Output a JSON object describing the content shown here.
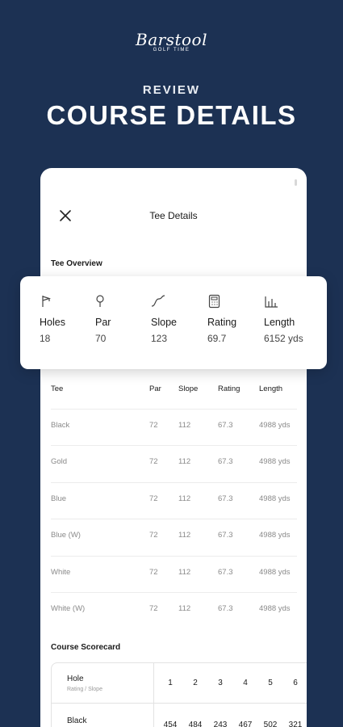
{
  "brand": {
    "name": "Barstool",
    "tagline": "GOLF TIME"
  },
  "promo": {
    "eyebrow": "REVIEW",
    "headline": "COURSE DETAILS"
  },
  "screen": {
    "title": "Tee Details",
    "overview_label": "Tee Overview",
    "scorecard_label": "Course Scorecard"
  },
  "overview": [
    {
      "icon": "flag-icon",
      "label": "Holes",
      "value": "18"
    },
    {
      "icon": "pin-icon",
      "label": "Par",
      "value": "70"
    },
    {
      "icon": "slope-icon",
      "label": "Slope",
      "value": "123"
    },
    {
      "icon": "calculator-icon",
      "label": "Rating",
      "value": "69.7"
    },
    {
      "icon": "length-icon",
      "label": "Length",
      "value": "6152 yds"
    }
  ],
  "tee_table": {
    "headers": {
      "tee": "Tee",
      "par": "Par",
      "slope": "Slope",
      "rating": "Rating",
      "length": "Length"
    },
    "rows": [
      {
        "tee": "Black",
        "par": "72",
        "slope": "112",
        "rating": "67.3",
        "length": "4988 yds"
      },
      {
        "tee": "Gold",
        "par": "72",
        "slope": "112",
        "rating": "67.3",
        "length": "4988 yds"
      },
      {
        "tee": "Blue",
        "par": "72",
        "slope": "112",
        "rating": "67.3",
        "length": "4988 yds"
      },
      {
        "tee": "Blue (W)",
        "par": "72",
        "slope": "112",
        "rating": "67.3",
        "length": "4988 yds"
      },
      {
        "tee": "White",
        "par": "72",
        "slope": "112",
        "rating": "67.3",
        "length": "4988 yds"
      },
      {
        "tee": "White (W)",
        "par": "72",
        "slope": "112",
        "rating": "67.3",
        "length": "4988 yds"
      }
    ]
  },
  "scorecard": {
    "hole_label": "Hole",
    "hole_sub": "Rating / Slope",
    "holes": [
      "1",
      "2",
      "3",
      "4",
      "5",
      "6"
    ],
    "rows": [
      {
        "tee": "Black",
        "yards": [
          "454",
          "484",
          "243",
          "467",
          "502",
          "321"
        ]
      }
    ]
  },
  "colors": {
    "background": "#1c3153",
    "card": "#ffffff"
  }
}
